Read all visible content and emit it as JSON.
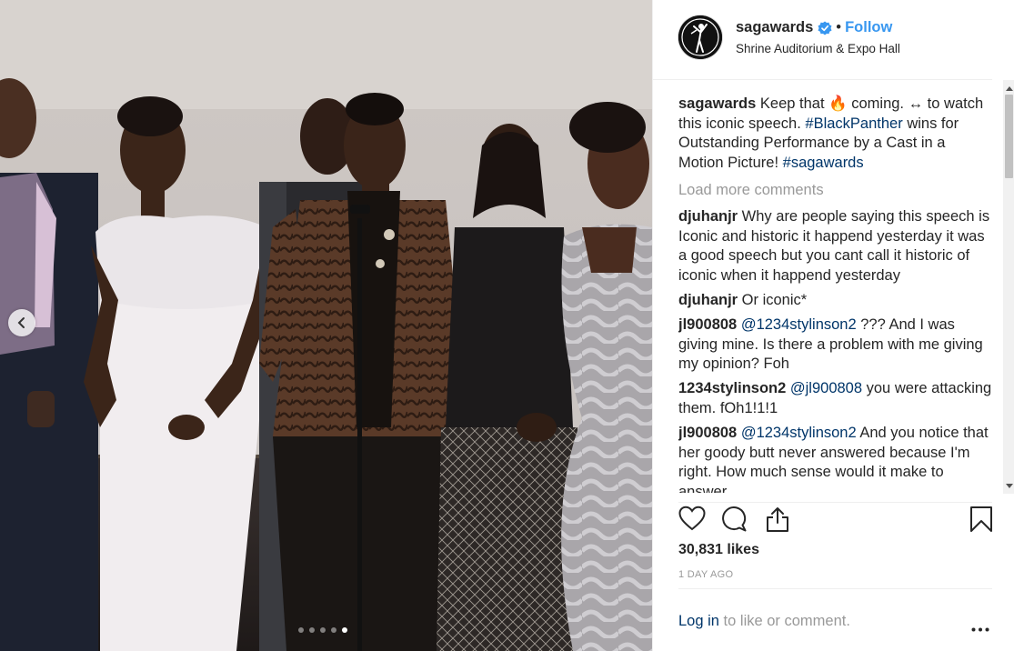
{
  "post": {
    "username": "sagawards",
    "separator": "•",
    "follow_label": "Follow",
    "location": "Shrine Auditorium & Expo Hall",
    "caption": {
      "username": "sagawards",
      "text_1": " Keep that ",
      "emoji": "🔥",
      "text_2": " coming. ↔ to watch this iconic speech. ",
      "tag_1": "#BlackPanther",
      "text_3": " wins for Outstanding Performance by a Cast in a Motion Picture! ",
      "tag_2": "#sagawards"
    },
    "load_more_label": "Load more comments",
    "comments": [
      {
        "username": "djuhanjr",
        "mention": "",
        "text": " Why are people saying this speech is Iconic and historic it happend yesterday it was a good speech but you cant call it historic of iconic when it happend yesterday"
      },
      {
        "username": "djuhanjr",
        "mention": "",
        "text": " Or iconic*"
      },
      {
        "username": "jl900808",
        "mention": " @1234stylinson2",
        "text": " ??? And I was giving mine. Is there a problem with me giving my opinion? Foh"
      },
      {
        "username": "1234stylinson2",
        "mention": " @jl900808",
        "text": " you were attacking them. fOh1!1!1"
      },
      {
        "username": "jl900808",
        "mention": " @1234stylinson2",
        "text": " And you notice that her goody butt never answered because I'm right. How much sense would it make to answer"
      }
    ],
    "likes": "30,831 likes",
    "time_ago": "1 DAY AGO",
    "login_link": "Log in",
    "login_rest": " to like or comment."
  },
  "icons": {
    "verified": "verified-badge-icon",
    "like": "heart-icon",
    "comment": "comment-icon",
    "share": "share-icon",
    "save": "bookmark-icon",
    "more": "more-options-icon",
    "prev": "chevron-left-icon"
  },
  "colors": {
    "accent": "#3897f0",
    "hashtag": "#003569",
    "muted": "#999999",
    "text": "#262626"
  },
  "carousel": {
    "count": 5,
    "active": 5
  }
}
